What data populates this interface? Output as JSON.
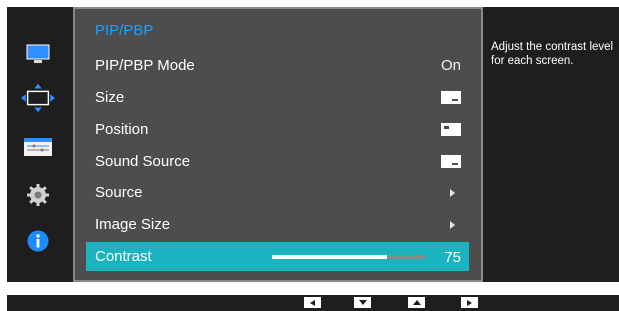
{
  "menu": {
    "title": "PIP/PBP",
    "items": [
      {
        "label": "PIP/PBP Mode",
        "value": "On"
      },
      {
        "label": "Size"
      },
      {
        "label": "Position"
      },
      {
        "label": "Sound Source"
      },
      {
        "label": "Source"
      },
      {
        "label": "Image Size"
      },
      {
        "label": "Contrast",
        "value": "75"
      }
    ],
    "contrast_level": 75
  },
  "help": {
    "text": "Adjust the contrast level for each screen."
  },
  "sidebar": {
    "icons": [
      "picture-icon",
      "size-position-icon",
      "pip-pbp-icon",
      "settings-gear-icon",
      "information-icon"
    ]
  },
  "nav": {
    "buttons": [
      "left-arrow-icon",
      "down-arrow-icon",
      "up-arrow-icon",
      "right-arrow-icon"
    ]
  },
  "colors": {
    "title_blue": "#1aa0ff",
    "selected_teal": "#1bb3bf",
    "panel_gray": "#4d4d4d",
    "frame_black": "#1e1e1e"
  }
}
